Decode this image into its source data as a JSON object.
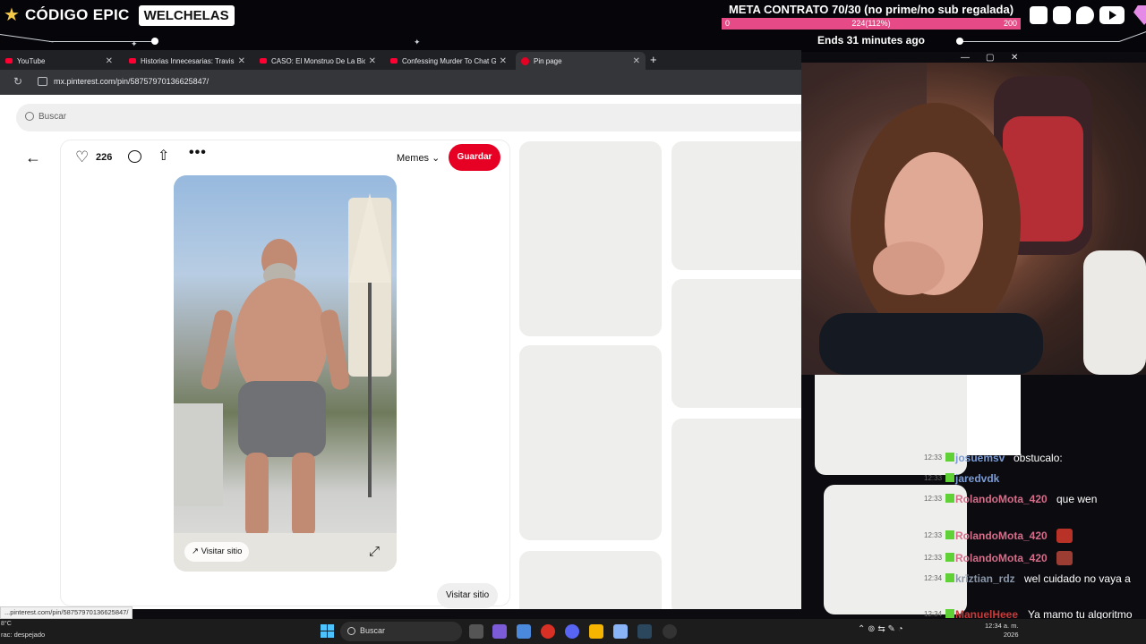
{
  "overlay": {
    "brand_left": "CÓDIGO EPIC",
    "brand_right": "WELCHELAS",
    "meta_title": "META CONTRATO 70/30 (no prime/no sub regalada)",
    "meta_min": "0",
    "meta_progress": "224(112%)",
    "meta_max": "200",
    "meta_fill_fraction": 1.0,
    "meta_ends": "Ends 31 minutes ago",
    "socials": [
      "twitch-icon",
      "instagram-icon",
      "twitter-icon",
      "youtube-icon"
    ]
  },
  "browser": {
    "tabs": [
      {
        "label": "YouTube",
        "icon": "youtube-icon"
      },
      {
        "label": "Historias Innecesarias: Travis el",
        "icon": "youtube-icon"
      },
      {
        "label": "CASO: El Monstruo De La Biciclé",
        "icon": "youtube-icon"
      },
      {
        "label": "Confessing Murder To Chat GPT",
        "icon": "youtube-icon"
      },
      {
        "label": "Pin page",
        "icon": "pinterest-icon",
        "active": true
      }
    ],
    "url": "mx.pinterest.com/pin/587579701366258​47/",
    "status_url": "...pinterest.com/pin/587579701366258​47/"
  },
  "pinterest": {
    "search_placeholder": "Buscar",
    "likes": "226",
    "board": "Memes",
    "save_label": "Guardar",
    "visit_chip": "Visitar sitio",
    "visit_button": "Visitar sitio",
    "accent": "#e60023"
  },
  "chat": [
    {
      "time": "12:33",
      "user": "josuemsv",
      "color": "blue",
      "message": "obstucalo:"
    },
    {
      "time": "12:33",
      "user": "jaredvdk",
      "color": "blue",
      "message": ""
    },
    {
      "time": "12:33",
      "user": "RolandoMota_420",
      "color": "pink",
      "message": "que wen"
    },
    {
      "time": "12:33",
      "user": "RolandoMota_420",
      "color": "pink",
      "message": "emote"
    },
    {
      "time": "12:33",
      "user": "RolandoMota_420",
      "color": "pink",
      "message": "emote"
    },
    {
      "time": "12:34",
      "user": "krīztian_rdz",
      "color": "gray",
      "message": "wel cuidado no vaya a"
    },
    {
      "time": "12:34",
      "user": "ManuelHeee",
      "color": "red",
      "message": "Ya mamo tu algoritmo"
    }
  ],
  "taskbar": {
    "weather_temp": "8°C",
    "weather_desc": "rac: despejado",
    "search_label": "Buscar",
    "time": "12:34 a. m.",
    "date": "2026"
  }
}
